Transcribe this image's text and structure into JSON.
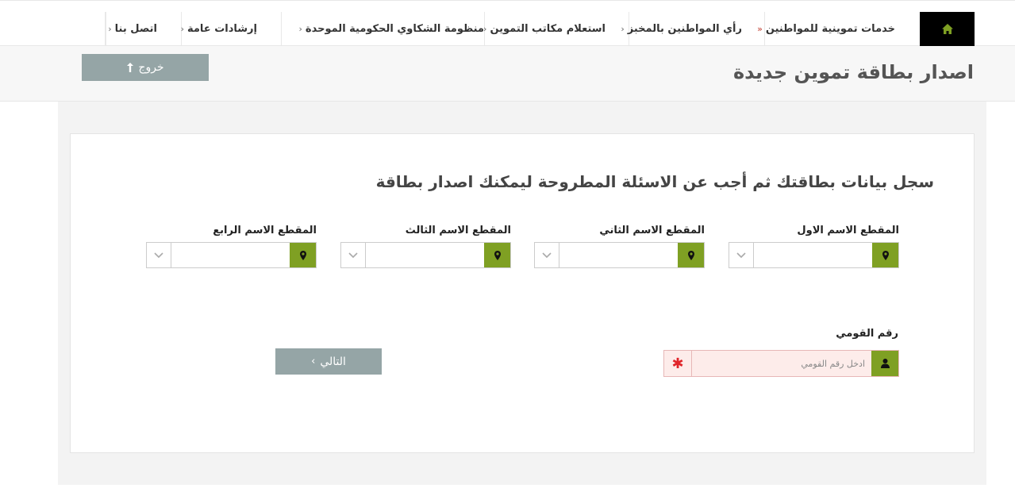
{
  "nav": {
    "items": [
      {
        "label": "خدمات تموينية للمواطنين",
        "chevron": "»"
      },
      {
        "label": "رأي المواطنين بالمخبز",
        "chevron": "›"
      },
      {
        "label": "استعلام مكاتب التموين",
        "chevron": "›"
      },
      {
        "label": "منظومة الشكاوي الحكومية الموحدة",
        "chevron": "›"
      },
      {
        "label": "إرشادات عامة",
        "chevron": "›"
      },
      {
        "label": "اتصل بنا",
        "chevron": "›"
      }
    ]
  },
  "header": {
    "title": "اصدار بطاقة تموين جديدة",
    "logout_label": "خروج"
  },
  "form": {
    "intro": "سجل بيانات بطاقتك ثم أجب عن الاسئلة المطروحة ليمكنك اصدار بطاقة",
    "name_parts": [
      {
        "label": "المقطع الاسم الاول"
      },
      {
        "label": "المقطع الاسم الثاني"
      },
      {
        "label": "المقطع الاسم الثالث"
      },
      {
        "label": "المقطع الاسم الرابع"
      }
    ],
    "national_id": {
      "label": "رقم القومي",
      "placeholder": "ادخل رقم القومي",
      "value": ""
    },
    "next_label": "التالي"
  },
  "colors": {
    "accent": "#7fa023",
    "button_gray": "#95a5a6",
    "required_red": "#e0262b"
  }
}
